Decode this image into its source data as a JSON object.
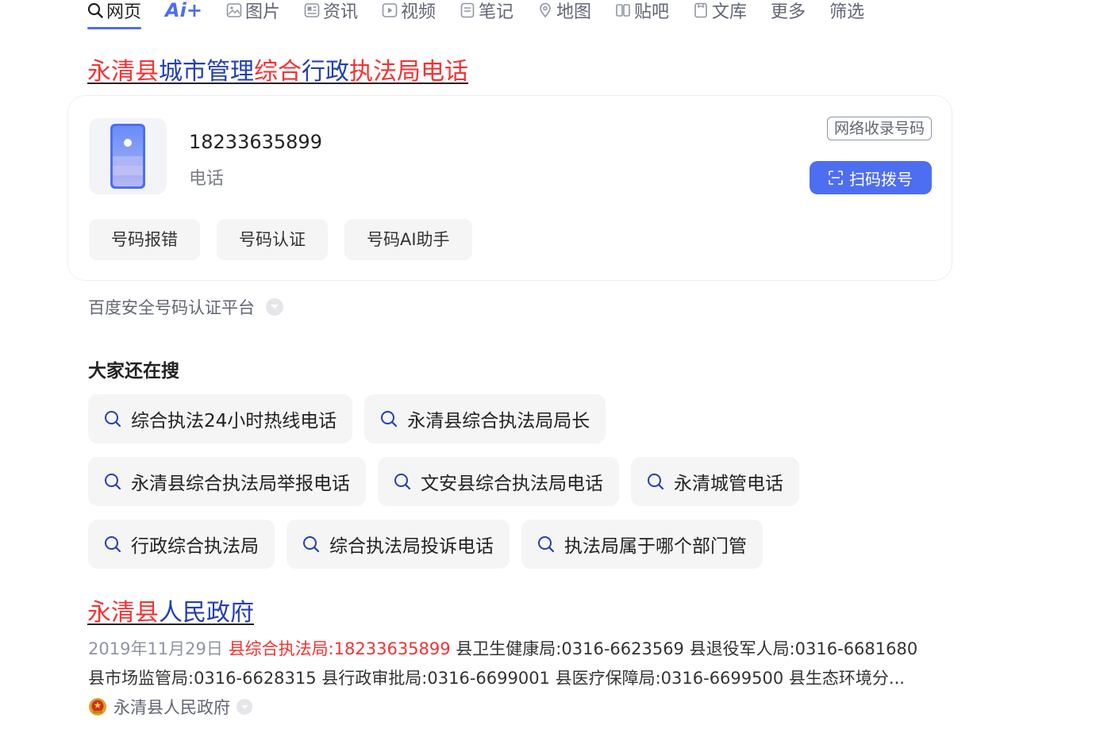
{
  "tabs": [
    {
      "label": "网页",
      "icon": "search-icon"
    },
    {
      "label": "Ai+",
      "icon": "ai-icon"
    },
    {
      "label": "图片",
      "icon": "image-icon"
    },
    {
      "label": "资讯",
      "icon": "news-icon"
    },
    {
      "label": "视频",
      "icon": "video-icon"
    },
    {
      "label": "笔记",
      "icon": "note-icon"
    },
    {
      "label": "地图",
      "icon": "map-icon"
    },
    {
      "label": "贴吧",
      "icon": "tieba-icon"
    },
    {
      "label": "文库",
      "icon": "wenku-icon"
    },
    {
      "label": "更多"
    },
    {
      "label": "筛选"
    }
  ],
  "result1": {
    "title_parts": [
      "永清县",
      "城市管理",
      "综合",
      "行政",
      "执法局电话"
    ],
    "phone_number": "18233635899",
    "phone_label": "电话",
    "badge": "网络收录号码",
    "scan_button": "扫码拨号",
    "actions": [
      "号码报错",
      "号码认证",
      "号码AI助手"
    ],
    "source": "百度安全号码认证平台"
  },
  "also_search": {
    "title": "大家还在搜",
    "rows": [
      [
        "综合执法24小时热线电话",
        "永清县综合执法局局长"
      ],
      [
        "永清县综合执法局举报电话",
        "文安县综合执法局电话",
        "永清城管电话"
      ],
      [
        "行政综合执法局",
        "综合执法局投诉电话",
        "执法局属于哪个部门管"
      ]
    ]
  },
  "result2": {
    "title_red": "永清县",
    "title_blue": "人民政府",
    "date": "2019年11月29日",
    "highlight": "县综合执法局:18233635899",
    "abstract_rest": " 县卫生健康局:0316-6623569 县退役军人局:0316-6681680 县市场监管局:0316-6628315 县行政审批局:0316-6699001 县医疗保障局:0316-6699500 县生态环境分...",
    "source": "永清县人民政府"
  },
  "colors": {
    "accent": "#4e6ef2",
    "highlight_red": "#f73131",
    "link_blue": "#2440b3"
  }
}
